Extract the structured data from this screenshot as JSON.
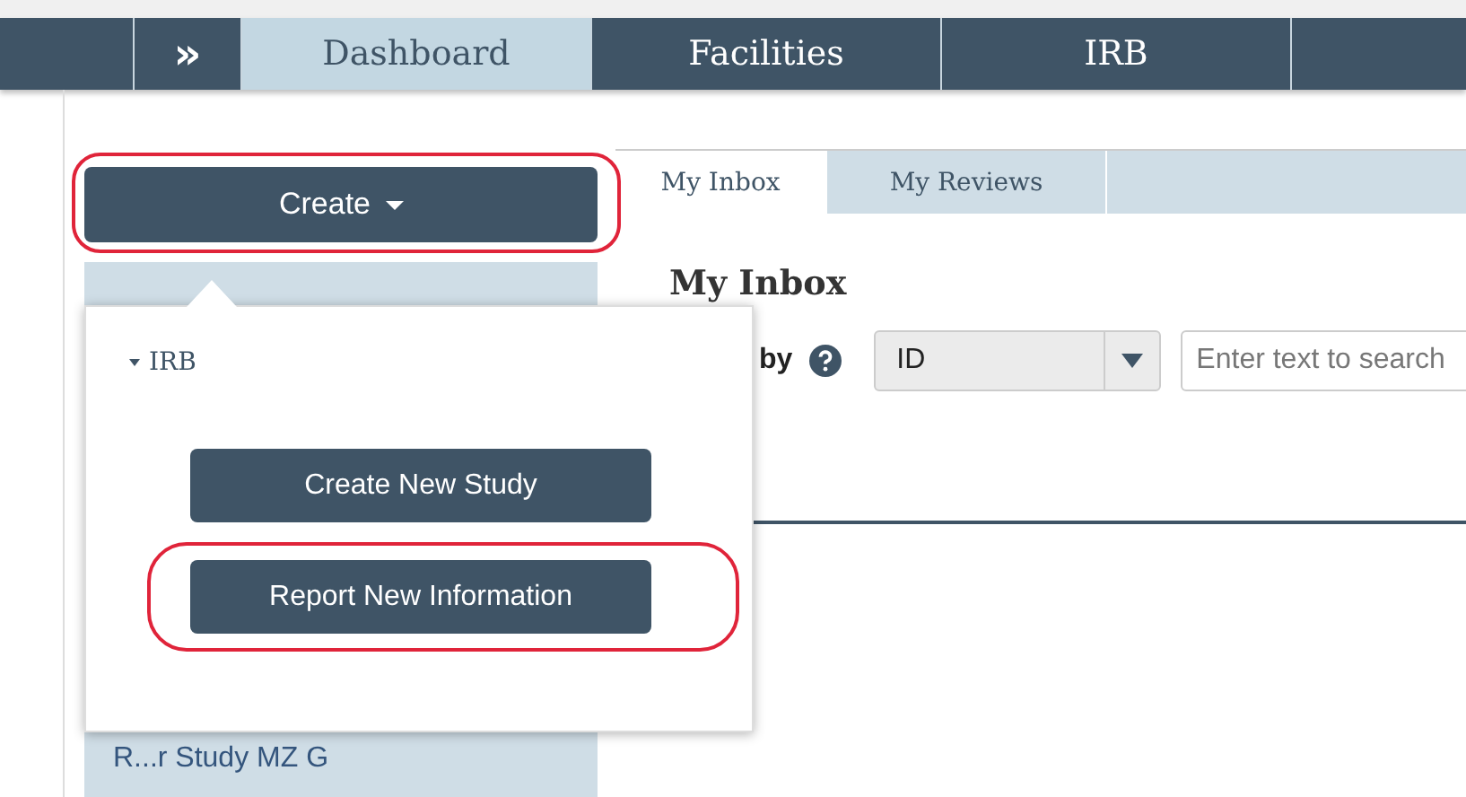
{
  "topnav": {
    "items": [
      {
        "kind": "expand",
        "label": "»",
        "selected": false
      },
      {
        "kind": "tab",
        "label": "Dashboard",
        "selected": true
      },
      {
        "kind": "tab",
        "label": "Facilities",
        "selected": false
      },
      {
        "kind": "tab",
        "label": "IRB",
        "selected": false
      }
    ]
  },
  "sidebar": {
    "create_button": {
      "label": "Create",
      "highlighted": true
    },
    "item": "R...r Study MZ G"
  },
  "create_menu": {
    "section": "IRB",
    "expanded": true,
    "buttons": [
      {
        "label": "Create New Study",
        "highlighted": false
      },
      {
        "label": "Report New Information",
        "highlighted": true
      }
    ]
  },
  "content": {
    "tabs": [
      {
        "label": "My Inbox",
        "selected": true
      },
      {
        "label": "My Reviews",
        "selected": false
      }
    ],
    "heading": "My Inbox",
    "filter_label": "by",
    "filter_select": {
      "value": "ID"
    },
    "search": {
      "placeholder": "Enter text to search"
    }
  }
}
